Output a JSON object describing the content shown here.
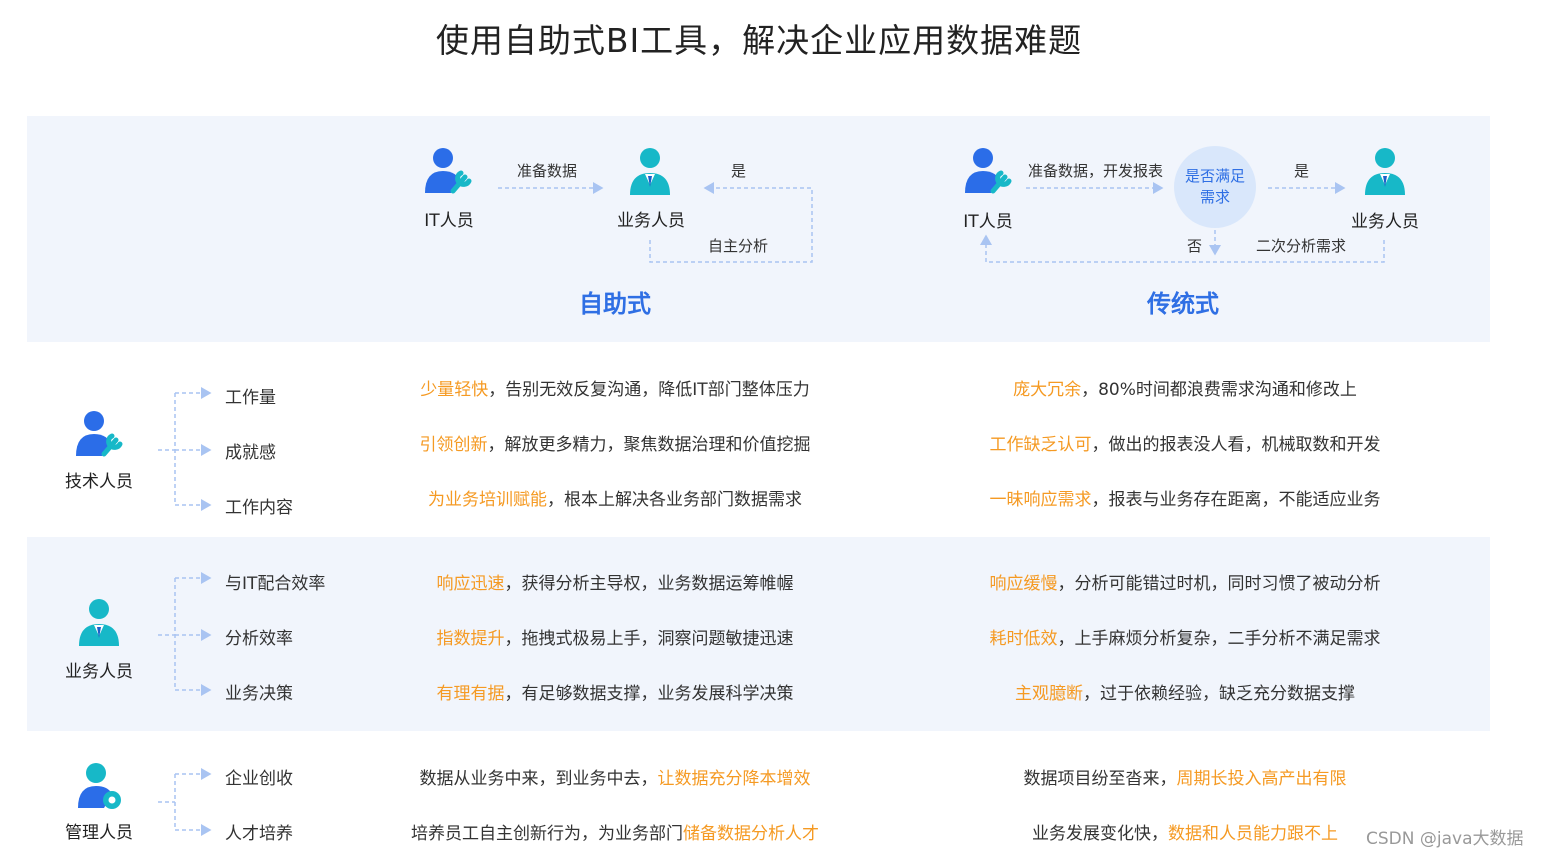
{
  "title": "使用自助式BI工具，解决企业应用数据难题",
  "top": {
    "self_service": {
      "it_label": "IT人员",
      "business_label": "业务人员",
      "arrow_label": "准备数据",
      "yes_label": "是",
      "loop_label": "自主分析",
      "mode_label": "自助式"
    },
    "traditional": {
      "it_label": "IT人员",
      "business_label": "业务人员",
      "arrow_label": "准备数据，开发报表",
      "decision_label": "是否满足需求",
      "yes_label": "是",
      "no_label": "否",
      "loop_label": "二次分析需求",
      "mode_label": "传统式"
    }
  },
  "groups": [
    {
      "role": "技术人员",
      "icon": "tech-person-wrench-icon",
      "rows": [
        {
          "category": "工作量",
          "self_hl": "少量轻快",
          "self_rest": "，告别无效反复沟通，降低IT部门整体压力",
          "trad_hl": "庞大冗余",
          "trad_rest": "，80%时间都浪费需求沟通和修改上"
        },
        {
          "category": "成就感",
          "self_hl": "引领创新",
          "self_rest": "，解放更多精力，聚焦数据治理和价值挖掘",
          "trad_hl": "工作缺乏认可",
          "trad_rest": "，做出的报表没人看，机械取数和开发"
        },
        {
          "category": "工作内容",
          "self_hl": "为业务培训赋能",
          "self_rest": "，根本上解决各业务部门数据需求",
          "trad_hl": "一昧响应需求",
          "trad_rest": "，报表与业务存在距离，不能适应业务"
        }
      ]
    },
    {
      "role": "业务人员",
      "icon": "business-person-icon",
      "rows": [
        {
          "category": "与IT配合效率",
          "self_hl": "响应迅速",
          "self_rest": "，获得分析主导权，业务数据运筹帷幄",
          "trad_hl": "响应缓慢",
          "trad_rest": "，分析可能错过时机，同时习惯了被动分析"
        },
        {
          "category": "分析效率",
          "self_hl": "指数提升",
          "self_rest": "，拖拽式极易上手，洞察问题敏捷迅速",
          "trad_hl": "耗时低效",
          "trad_rest": "，上手麻烦分析复杂，二手分析不满足需求"
        },
        {
          "category": "业务决策",
          "self_hl": "有理有据",
          "self_rest": "，有足够数据支撑，业务发展科学决策",
          "trad_hl": "主观臆断",
          "trad_rest": "，过于依赖经验，缺乏充分数据支撑"
        }
      ]
    },
    {
      "role": "管理人员",
      "icon": "manager-person-gear-icon",
      "rows": [
        {
          "category": "企业创收",
          "self_pre": "数据从业务中来，到业务中去，",
          "self_hl": "让数据充分降本增效",
          "trad_pre": "数据项目纷至沓来，",
          "trad_hl": "周期长投入高产出有限"
        },
        {
          "category": "人才培养",
          "self_pre": "培养员工自主创新行为，为业务部门",
          "self_hl": "储备数据分析人才",
          "trad_pre": "业务发展变化快，",
          "trad_hl": "数据和人员能力跟不上"
        }
      ]
    }
  ],
  "watermark": "CSDN @java大数据",
  "colors": {
    "accent_blue": "#2f6fe4",
    "highlight_orange": "#f59a23",
    "band_bg": "#f1f5fc",
    "icon_blue": "#2b6de8",
    "icon_teal": "#17b8c8",
    "dash": "#a9c4f2"
  }
}
